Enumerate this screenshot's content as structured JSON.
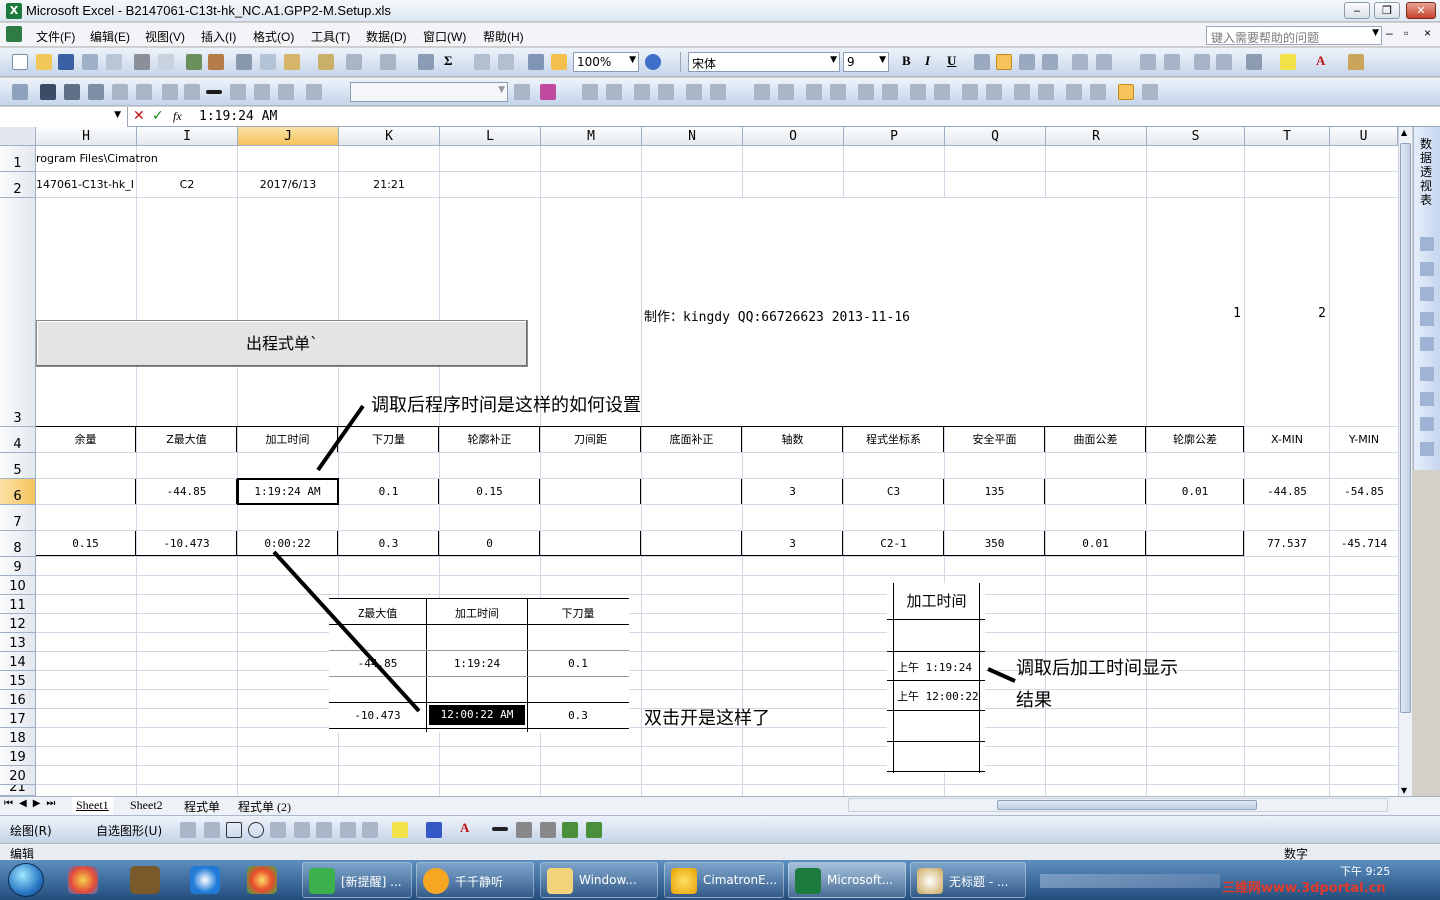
{
  "window": {
    "title": "Microsoft Excel - B2147061-C13t-hk_NC.A1.GPP2-M.Setup.xls",
    "app_icon": "X",
    "buttons": {
      "minimize": "‒",
      "restore": "❐",
      "close": "✕"
    }
  },
  "menu": {
    "items": [
      "文件(F)",
      "编辑(E)",
      "视图(V)",
      "插入(I)",
      "格式(O)",
      "工具(T)",
      "数据(D)",
      "窗口(W)",
      "帮助(H)"
    ],
    "help_placeholder": "键入需要帮助的问题"
  },
  "toolbar": {
    "zoom": "100%",
    "font_name": "宋体",
    "font_size": "9",
    "bold": "B",
    "italic": "I",
    "underline": "U"
  },
  "formula_bar": {
    "name_box": "",
    "cancel": "✕",
    "enter": "✓",
    "fx": "fx",
    "content": "1:19:24 AM"
  },
  "columns": [
    "H",
    "I",
    "J",
    "K",
    "L",
    "M",
    "N",
    "O",
    "P",
    "Q",
    "R",
    "S",
    "T",
    "U"
  ],
  "rows": [
    "1",
    "2",
    "3",
    "4",
    "5",
    "6",
    "7",
    "8",
    "9",
    "10",
    "11",
    "12",
    "13",
    "14",
    "15",
    "16",
    "17",
    "18",
    "19",
    "20",
    "21"
  ],
  "cells": {
    "h1": "rogram Files\\Cimatron",
    "h2": "147061-C13t-hk_I",
    "i2": "C2",
    "j2": "2017/6/13",
    "k2": "21:21",
    "credit": "制作：kingdy QQ:66726623 2013-11-16",
    "s3": "1",
    "t3": "2",
    "macro_button": "出程式单`",
    "headers4": [
      "余量",
      "Z最大值",
      "加工时间",
      "下刀量",
      "轮廓补正",
      "刀间距",
      "底面补正",
      "轴数",
      "程式坐标系",
      "安全平面",
      "曲面公差",
      "轮廓公差",
      "X-MIN",
      "Y-MIN"
    ],
    "row6": [
      "",
      "-44.85",
      "1:19:24 AM",
      "0.1",
      "0.15",
      "",
      "",
      "3",
      "C3",
      "135",
      "",
      "0.01",
      "-44.85",
      "-54.85"
    ],
    "row8": [
      "0.15",
      "-10.473",
      "0:00:22",
      "0.3",
      "0",
      "",
      "",
      "3",
      "C2-1",
      "350",
      "0.01",
      "",
      "77.537",
      "-45.714"
    ]
  },
  "annotations": {
    "top": "调取后程序时间是这样的如何设置",
    "double_click": "双击开是这样了",
    "result_line1": "调取后加工时间显示",
    "result_line2": "结果"
  },
  "inset1": {
    "headers": [
      "Z最大值",
      "加工时间",
      "下刀量"
    ],
    "row1": [
      "-44.85",
      "1:19:24",
      "0.1"
    ],
    "row2": [
      "-10.473",
      "12:00:22 AM",
      "0.3"
    ]
  },
  "inset2": {
    "header": "加工时间",
    "rows": [
      "上午 1:19:24",
      "上午 12:00:22"
    ]
  },
  "task_pane": {
    "label": "数据透视表"
  },
  "sheet_tabs": [
    "Sheet1",
    "Sheet2",
    "程式单",
    "程式单 (2)"
  ],
  "draw_toolbar": {
    "draw": "绘图(R)",
    "autoshapes": "自选图形(U)"
  },
  "status": {
    "mode": "编辑",
    "numlock": "数字"
  },
  "taskbar": {
    "tasks": [
      "[新提醒] ...",
      "千千静听",
      "Window...",
      "CimatronE...",
      "Microsoft...",
      "无标题 - ..."
    ],
    "clock": "下午 9:25",
    "watermark": "三维网www.3dportal.cn"
  },
  "colors": {
    "selected_header": "#f6c35b",
    "grid": "#d0d7e5",
    "title_bg": "#dfe8f0"
  }
}
